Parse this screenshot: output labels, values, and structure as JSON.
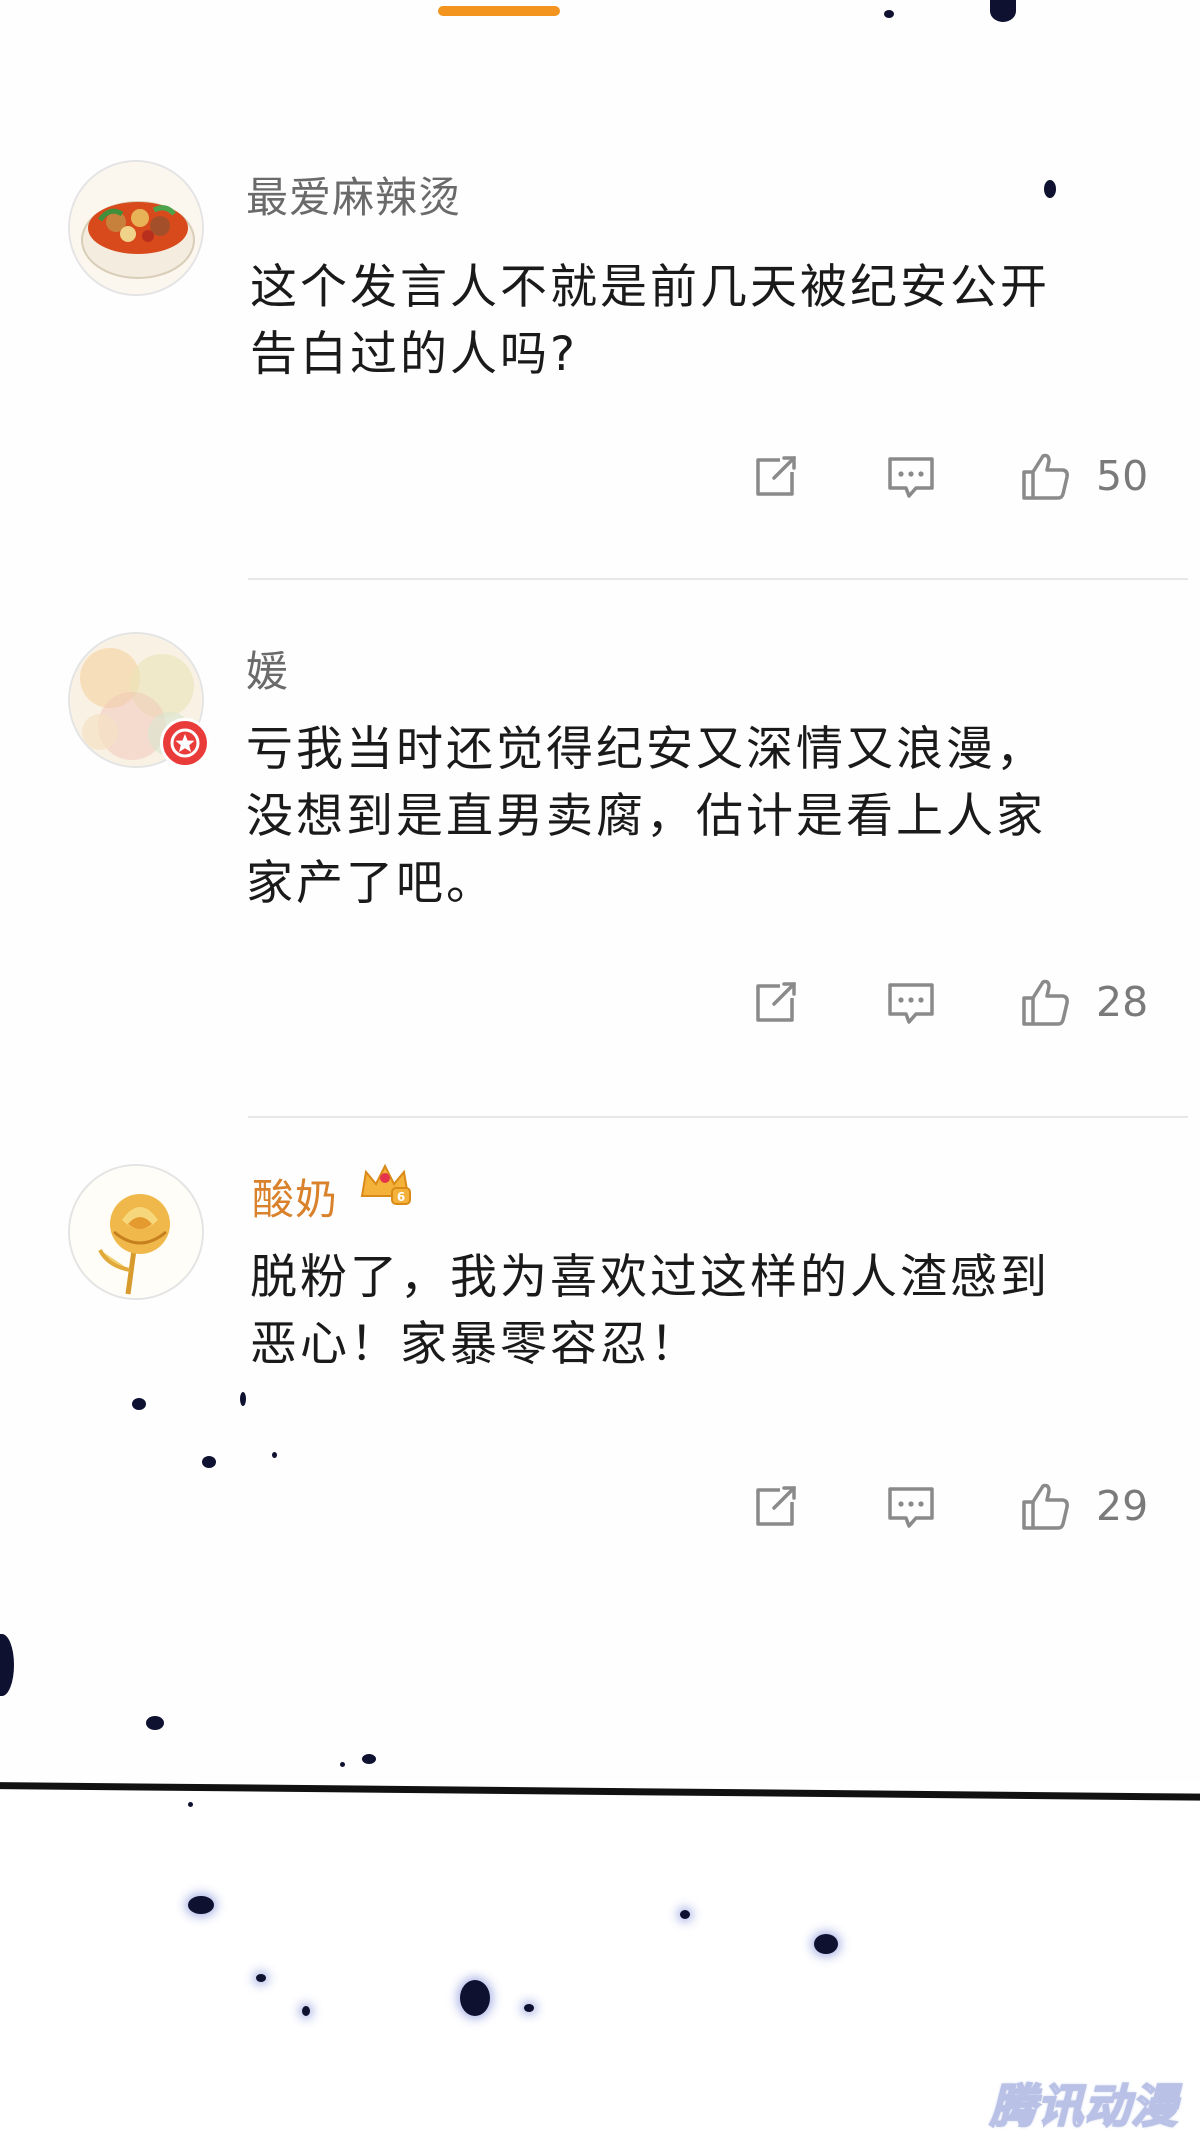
{
  "comments": [
    {
      "username": "最爱麻辣烫",
      "content": "这个发言人不就是前几天被纪安公开告白过的人吗?",
      "likes": "50",
      "avatar": "hotpot-bowl-avatar"
    },
    {
      "username": "媛",
      "content": "亏我当时还觉得纪安又深情又浪漫，没想到是直男卖腐，估计是看上人家家产了吧。",
      "likes": "28",
      "avatar": "watercolor-avatar"
    },
    {
      "username": "酸奶",
      "vip_level": "6",
      "content": "脱粉了，我为喜欢过这样的人渣感到恶心！家暴零容忍！",
      "likes": "29",
      "avatar": "golden-rose-avatar"
    }
  ],
  "watermark": "腾讯动漫",
  "colors": {
    "accent_pill": "#f2941d",
    "vip_name": "#d9822b",
    "ink_petals": "#0e1130"
  },
  "icons": [
    "share-icon",
    "comment-icon",
    "thumbs-up-icon",
    "crown-icon",
    "verified-badge-icon"
  ]
}
